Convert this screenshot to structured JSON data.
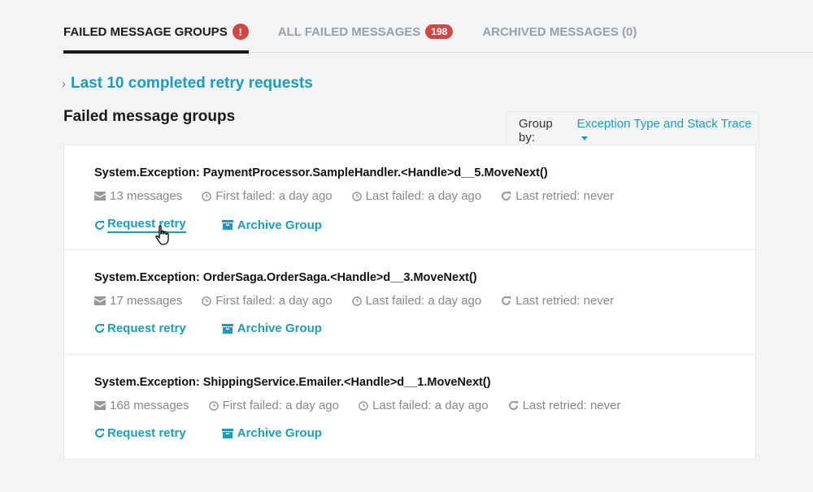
{
  "tabs": [
    {
      "label": "FAILED MESSAGE GROUPS",
      "badge": "!",
      "active": true
    },
    {
      "label": "ALL FAILED MESSAGES",
      "badge": "198",
      "active": false
    },
    {
      "label": "ARCHIVED MESSAGES (0)",
      "badge": null,
      "active": false
    }
  ],
  "retry_requests": {
    "label": "Last 10 completed retry requests",
    "icon": "chevron-right-icon"
  },
  "section_title": "Failed message groups",
  "group_by": {
    "label": "Group by:",
    "value": "Exception Type and Stack Trace"
  },
  "groups": [
    {
      "title": "System.Exception: PaymentProcessor.SampleHandler.<Handle>d__5.MoveNext()",
      "messages": "13 messages",
      "first_failed": "First failed: a day ago",
      "last_failed": "Last failed: a day ago",
      "last_retried": "Last retried: never",
      "retry_label": "Request retry",
      "archive_label": "Archive Group"
    },
    {
      "title": "System.Exception: OrderSaga.OrderSaga.<Handle>d__3.MoveNext()",
      "messages": "17 messages",
      "first_failed": "First failed: a day ago",
      "last_failed": "Last failed: a day ago",
      "last_retried": "Last retried: never",
      "retry_label": "Request retry",
      "archive_label": "Archive Group"
    },
    {
      "title": "System.Exception: ShippingService.Emailer.<Handle>d__1.MoveNext()",
      "messages": "168 messages",
      "first_failed": "First failed: a day ago",
      "last_failed": "Last failed: a day ago",
      "last_retried": "Last retried: never",
      "retry_label": "Request retry",
      "archive_label": "Archive Group"
    }
  ],
  "colors": {
    "accent": "#1a9dbc",
    "badge": "#ce4844",
    "background": "#f2f4f5"
  }
}
